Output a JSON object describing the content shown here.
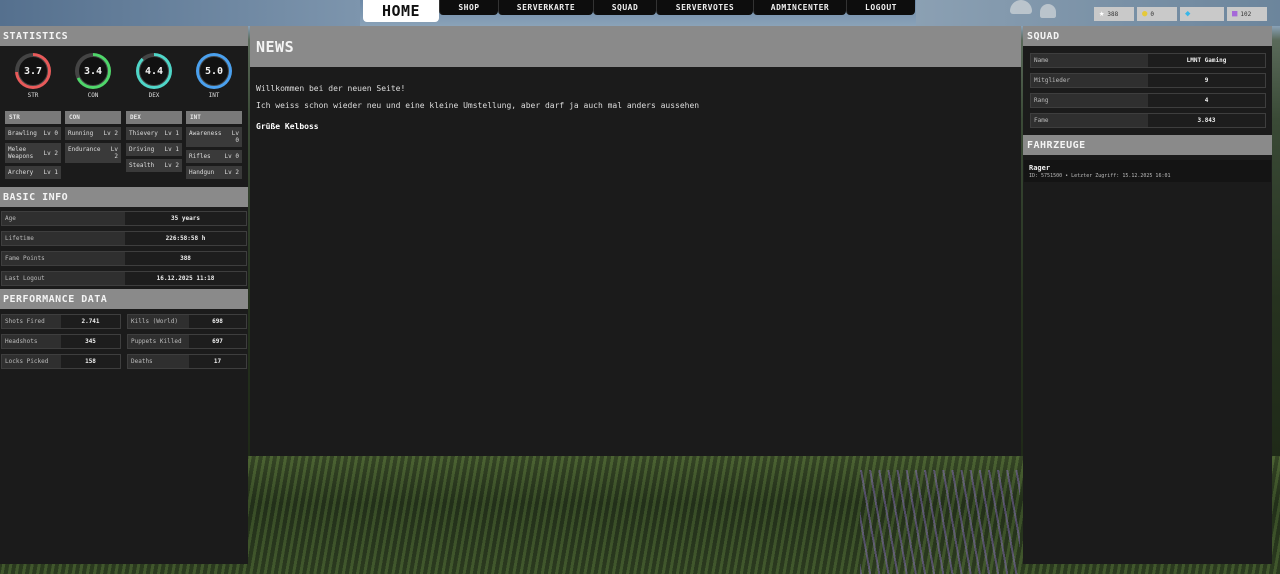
{
  "nav": {
    "home": "HOME",
    "shop": "SHOP",
    "serverkarte": "SERVERKARTE",
    "squad": "SQUAD",
    "servervotes": "SERVERVOTES",
    "admincenter": "ADMINCENTER",
    "logout": "LOGOUT"
  },
  "currency": [
    {
      "icon": "star-icon",
      "value": "388",
      "color": "#ffffff"
    },
    {
      "icon": "coin-icon",
      "value": "0",
      "color": "#e5c93a"
    },
    {
      "icon": "gem-icon",
      "value": "",
      "color": "#39b6e8"
    },
    {
      "icon": "ticket-icon",
      "value": "102",
      "color": "#a567d8"
    }
  ],
  "statistics": {
    "title": "STATISTICS",
    "rings": [
      {
        "label": "STR",
        "value": "3.7",
        "color": "#e85a5a"
      },
      {
        "label": "CON",
        "value": "3.4",
        "color": "#4fd66a"
      },
      {
        "label": "DEX",
        "value": "4.4",
        "color": "#4fd6c8"
      },
      {
        "label": "INT",
        "value": "5.0",
        "color": "#4aa0ee"
      }
    ],
    "columns": [
      {
        "head": "STR",
        "skills": [
          {
            "name": "Brawling",
            "lv": "Lv 0"
          },
          {
            "name": "Melee Weapons",
            "lv": "Lv 2"
          },
          {
            "name": "Archery",
            "lv": "Lv 1"
          }
        ]
      },
      {
        "head": "CON",
        "skills": [
          {
            "name": "Running",
            "lv": "Lv 2"
          },
          {
            "name": "Endurance",
            "lv": "Lv 2"
          }
        ]
      },
      {
        "head": "DEX",
        "skills": [
          {
            "name": "Thievery",
            "lv": "Lv 1"
          },
          {
            "name": "Driving",
            "lv": "Lv 1"
          },
          {
            "name": "Stealth",
            "lv": "Lv 2"
          }
        ]
      },
      {
        "head": "INT",
        "skills": [
          {
            "name": "Awareness",
            "lv": "Lv 0"
          },
          {
            "name": "Rifles",
            "lv": "Lv 0"
          },
          {
            "name": "Handgun",
            "lv": "Lv 2"
          }
        ]
      }
    ]
  },
  "basic_info": {
    "title": "BASIC INFO",
    "rows": [
      {
        "k": "Age",
        "v": "35 years"
      },
      {
        "k": "Lifetime",
        "v": "226:58:58 h"
      },
      {
        "k": "Fame Points",
        "v": "388"
      },
      {
        "k": "Last Logout",
        "v": "16.12.2025 11:18"
      }
    ]
  },
  "performance": {
    "title": "PERFORMANCE DATA",
    "left": [
      {
        "k": "Shots Fired",
        "v": "2.741"
      },
      {
        "k": "Headshots",
        "v": "345"
      },
      {
        "k": "Locks Picked",
        "v": "158"
      }
    ],
    "right": [
      {
        "k": "Kills (World)",
        "v": "698"
      },
      {
        "k": "Puppets Killed",
        "v": "697"
      },
      {
        "k": "Deaths",
        "v": "17"
      }
    ]
  },
  "news": {
    "title": "NEWS",
    "line1": "Willkommen bei der neuen Seite!",
    "line2": "Ich weiss schon wieder neu und eine kleine Umstellung, aber darf ja auch mal anders aussehen",
    "sign": "Grüße Kelboss"
  },
  "squad": {
    "title": "SQUAD",
    "rows": [
      {
        "k": "Name",
        "v": "LMNT Gaming"
      },
      {
        "k": "Mitglieder",
        "v": "9"
      },
      {
        "k": "Rang",
        "v": "4"
      },
      {
        "k": "Fame",
        "v": "3.843"
      }
    ]
  },
  "vehicles": {
    "title": "FAHRZEUGE",
    "items": [
      {
        "name": "Rager",
        "meta": "ID: 5751500 • Letzter Zugriff: 15.12.2025 16:01"
      }
    ]
  }
}
